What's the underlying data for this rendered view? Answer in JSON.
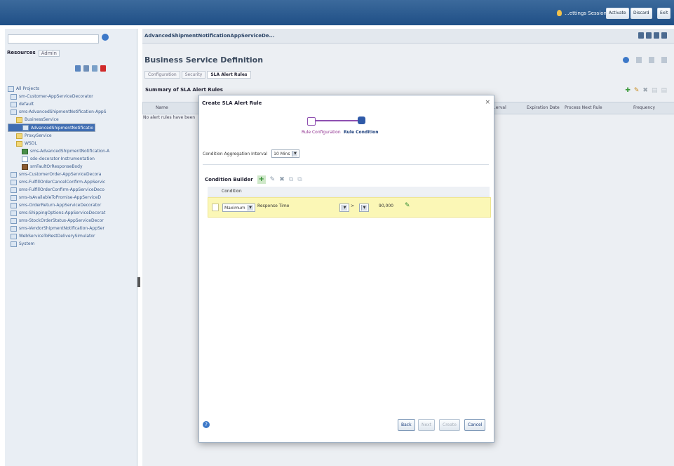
{
  "topbar": {
    "session_label": "...ettings Session",
    "buttons": [
      "Activate",
      "Discard",
      "Exit"
    ]
  },
  "resources": {
    "tab_active": "Resources",
    "tab_inactive": "Admin"
  },
  "tree": [
    {
      "label": "All Projects",
      "selected": false
    },
    {
      "label": "sm-Customer-AppServiceDecorator",
      "selected": false
    },
    {
      "label": "default",
      "selected": false
    },
    {
      "label": "sms-AdvancedShipmentNotification-AppS",
      "selected": false
    },
    {
      "label": "BusinessService",
      "selected": false
    },
    {
      "label": "AdvancedShipmentNotificatio",
      "selected": true
    },
    {
      "label": "ProxyService",
      "selected": false
    },
    {
      "label": "WSDL",
      "selected": false
    },
    {
      "label": "sms-AdvancedShipmentNotification-A",
      "selected": false
    },
    {
      "label": "sdo-decorator-Instrumentation",
      "selected": false
    },
    {
      "label": "smFaultOrResponseBody",
      "selected": false
    },
    {
      "label": "sms-CustomerOrder-AppServiceDecora",
      "selected": false
    },
    {
      "label": "sms-FulfillOrderCancelConfirm-AppServic",
      "selected": false
    },
    {
      "label": "sms-FulfillOrderConfirm-AppServiceDeco",
      "selected": false
    },
    {
      "label": "sms-IsAvailableToPromise-AppServiceD",
      "selected": false
    },
    {
      "label": "sms-OrderReturn-AppServiceDecorator",
      "selected": false
    },
    {
      "label": "sms-ShippingOptions-AppServiceDecorat",
      "selected": false
    },
    {
      "label": "sms-StockOrderStatus-AppServiceDecor",
      "selected": false
    },
    {
      "label": "sms-VendorShipmentNotification-AppSer",
      "selected": false
    },
    {
      "label": "WebServiceToRestDeliverySimulator",
      "selected": false
    },
    {
      "label": "System",
      "selected": false
    }
  ],
  "main": {
    "breadcrumb": "AdvancedShipmentNotificationAppServiceDe...",
    "title": "Business Service Definition",
    "tabs": [
      "Configuration",
      "Security",
      "SLA Alert Rules"
    ],
    "active_tab": "SLA Alert Rules",
    "summary": "Summary of SLA Alert Rules",
    "columns": [
      "Name",
      "...erval",
      "Expiration Date",
      "Process Next Rule",
      "Frequency"
    ],
    "no_rows": "No alert rules have been"
  },
  "dialog": {
    "title": "Create SLA Alert Rule",
    "close": "×",
    "train": [
      "Rule Configuration",
      "Rule Condition"
    ],
    "aggregation_label": "Condition Aggregation Interval",
    "aggregation_value": "10 Mins",
    "builder_label": "Condition Builder",
    "condition_header": "Condition",
    "condition": {
      "function": "Maximum",
      "metric": "Response Time",
      "operator": ">",
      "value": "90,000"
    },
    "buttons": {
      "back": "Back",
      "next": "Next",
      "create": "Create",
      "cancel": "Cancel"
    }
  }
}
